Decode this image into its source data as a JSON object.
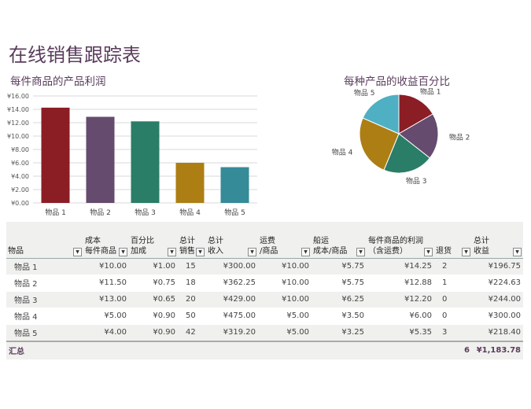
{
  "page": {
    "title": "在线销售跟踪表"
  },
  "bar_section": {
    "title": "每件商品的产品利润"
  },
  "pie_section": {
    "title": "每种产品的收益百分比"
  },
  "chart_data": [
    {
      "type": "bar",
      "title": "每件商品的产品利润",
      "categories": [
        "物品 1",
        "物品 2",
        "物品 3",
        "物品 4",
        "物品 5"
      ],
      "values": [
        14.25,
        12.88,
        12.2,
        6.0,
        5.35
      ],
      "colors": [
        "#8b1d25",
        "#654b6e",
        "#2a7d67",
        "#ad7e14",
        "#358b97"
      ],
      "ylim": [
        0,
        16
      ],
      "yticks": [
        "¥0.00",
        "¥2.00",
        "¥4.00",
        "¥6.00",
        "¥8.00",
        "¥10.00",
        "¥12.00",
        "¥14.00",
        "¥16.00"
      ],
      "grid": true
    },
    {
      "type": "pie",
      "title": "每种产品的收益百分比",
      "labels": [
        "物品 1",
        "物品 2",
        "物品 3",
        "物品 4",
        "物品 5"
      ],
      "values": [
        196.75,
        224.63,
        244.0,
        300.0,
        218.4
      ],
      "colors": [
        "#8b1d25",
        "#654b6e",
        "#2a7d67",
        "#ad7e14",
        "#4fb0c3"
      ]
    }
  ],
  "table": {
    "headers": [
      {
        "top": "",
        "bottom": "物品"
      },
      {
        "top": "成本",
        "bottom": "每件商品"
      },
      {
        "top": "百分比",
        "bottom": "加成"
      },
      {
        "top": "总计",
        "bottom": "销售"
      },
      {
        "top": "总计",
        "bottom": "收入"
      },
      {
        "top": "运费",
        "bottom": "/商品"
      },
      {
        "top": "船运",
        "bottom": "成本/商品"
      },
      {
        "top": "每件商品的利润",
        "bottom": "（含运费）"
      },
      {
        "top": "",
        "bottom": "退货"
      },
      {
        "top": "总计",
        "bottom": "收益"
      }
    ],
    "rows": [
      [
        "物品 1",
        "¥10.00",
        "¥1.00",
        "15",
        "¥300.00",
        "¥10.00",
        "¥5.75",
        "¥14.25",
        "2",
        "¥196.75"
      ],
      [
        "物品 2",
        "¥11.50",
        "¥0.75",
        "18",
        "¥362.25",
        "¥10.00",
        "¥5.75",
        "¥12.88",
        "1",
        "¥224.63"
      ],
      [
        "物品 3",
        "¥13.00",
        "¥0.65",
        "20",
        "¥429.00",
        "¥10.00",
        "¥6.25",
        "¥12.20",
        "0",
        "¥244.00"
      ],
      [
        "物品 4",
        "¥5.00",
        "¥0.90",
        "50",
        "¥475.00",
        "¥5.00",
        "¥3.50",
        "¥6.00",
        "0",
        "¥300.00"
      ],
      [
        "物品 5",
        "¥4.00",
        "¥0.90",
        "42",
        "¥319.20",
        "¥5.00",
        "¥3.25",
        "¥5.35",
        "3",
        "¥218.40"
      ]
    ],
    "total": {
      "label": "汇总",
      "returns": "6",
      "revenue": "¥1,183.78"
    }
  }
}
